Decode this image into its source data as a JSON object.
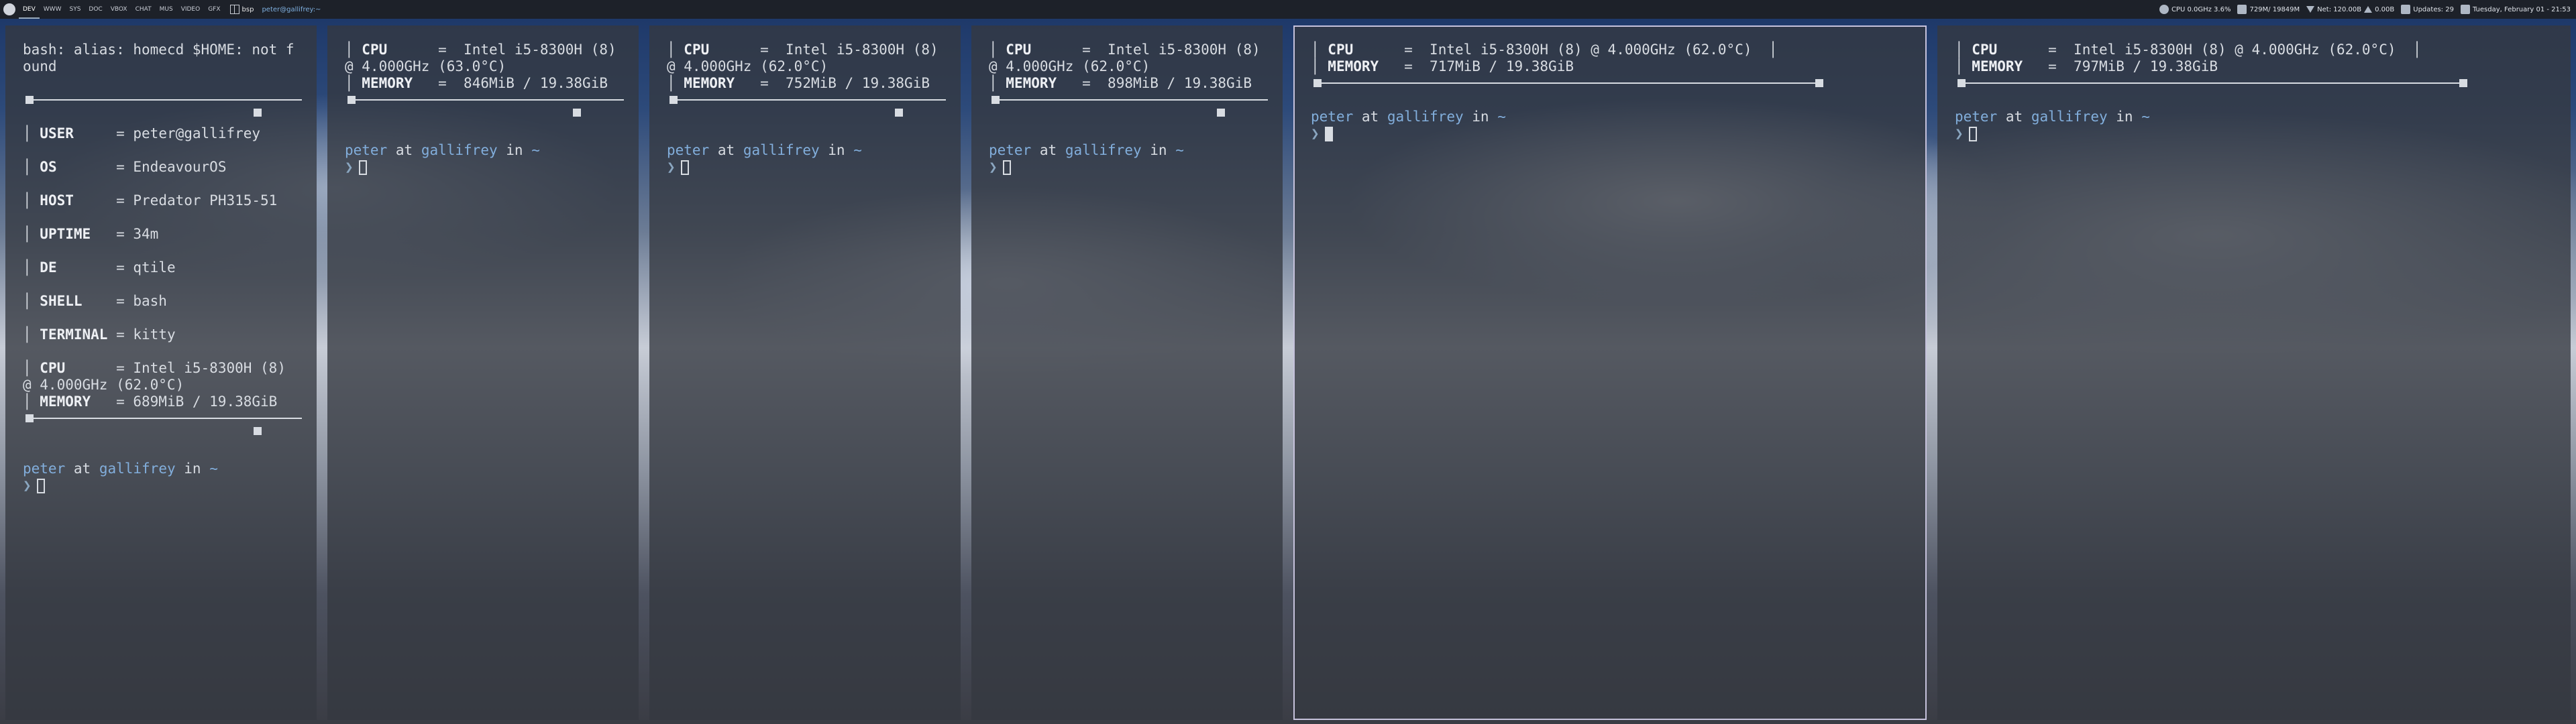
{
  "bar": {
    "workspaces": [
      "DEV",
      "WWW",
      "SYS",
      "DOC",
      "VBOX",
      "CHAT",
      "MUS",
      "VIDEO",
      "GFX"
    ],
    "layout": "bsp",
    "window_title": "peter@gallifrey:~",
    "cpu": "CPU 0.0GHz 3.6%",
    "memory": "729M/ 19849M",
    "net": "Net: 120.00B",
    "net_up": "0.00B",
    "updates": "Updates: 29",
    "clock": "Tuesday, February 01 - 21:53",
    "colors": {
      "background": "#1d2129",
      "accent": "#7fb0e0"
    }
  },
  "neofetch": {
    "error": "bash: alias: homecd $HOME: not found",
    "rows": [
      {
        "key": "USER",
        "value": "peter@gallifrey"
      },
      {
        "key": "OS",
        "value": "EndeavourOS"
      },
      {
        "key": "HOST",
        "value": "Predator PH315-51"
      },
      {
        "key": "UPTIME",
        "value": "34m"
      },
      {
        "key": "DE",
        "value": "qtile"
      },
      {
        "key": "SHELL",
        "value": "bash"
      },
      {
        "key": "TERMINAL",
        "value": "kitty"
      },
      {
        "key": "CPU",
        "value": "Intel i5-8300H (8) @ 4.000GHz (62.0°C)"
      },
      {
        "key": "MEMORY",
        "value": "689MiB / 19.38GiB"
      }
    ]
  },
  "prompt": {
    "user": "peter",
    "at": "at",
    "host": "gallifrey",
    "in": "in",
    "dir": "~",
    "arrow": "❯"
  },
  "terminals": [
    {
      "cpu": "Intel i5-8300H (8) @ 4.000GHz (63.0°C)",
      "memory": "846MiB / 19.38GiB"
    },
    {
      "cpu": "Intel i5-8300H (8) @ 4.000GHz (62.0°C)",
      "memory": "752MiB / 19.38GiB"
    },
    {
      "cpu": "Intel i5-8300H (8) @ 4.000GHz (62.0°C)",
      "memory": "898MiB / 19.38GiB"
    },
    {
      "cpu": "Intel i5-8300H (8) @ 4.000GHz (62.0°C)",
      "memory": "717MiB / 19.38GiB"
    },
    {
      "cpu": "Intel i5-8300H (8) @ 4.000GHz (62.0°C)",
      "memory": "797MiB / 19.38GiB"
    }
  ],
  "labels": {
    "cpu": "CPU",
    "memory": "MEMORY",
    "eq": "="
  }
}
